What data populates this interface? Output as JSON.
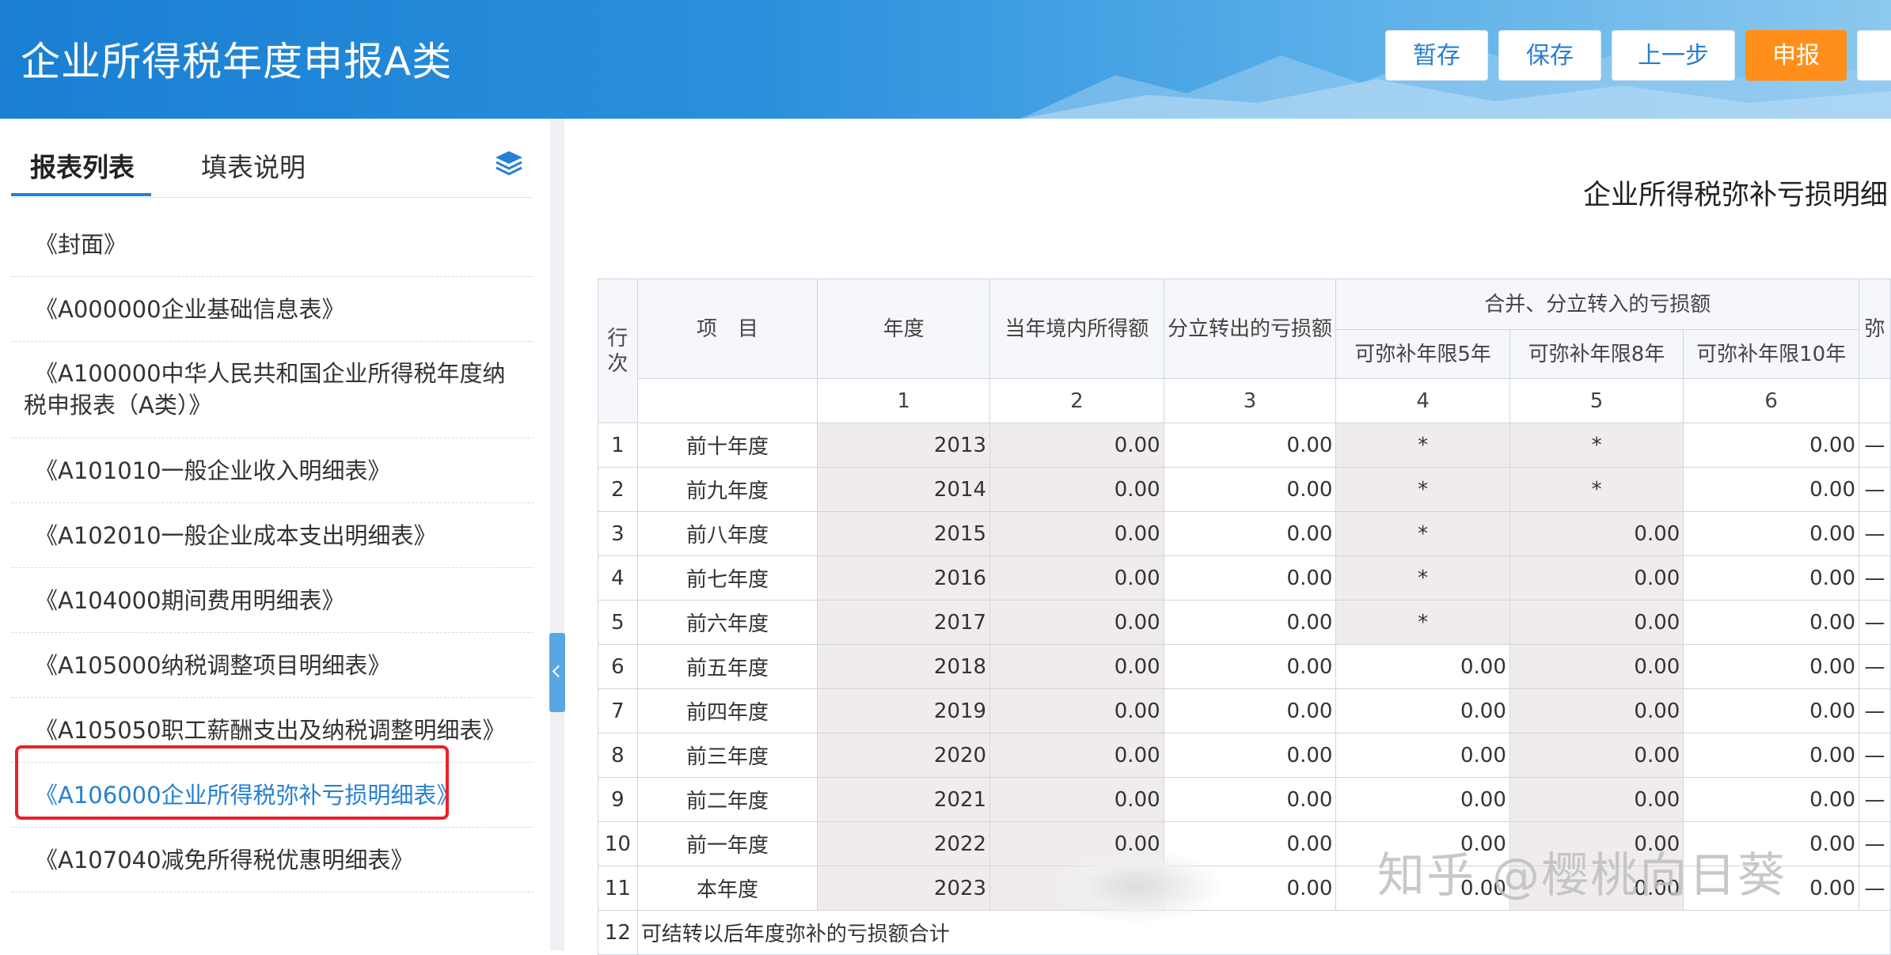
{
  "header": {
    "title": "企业所得税年度申报A类",
    "buttons": {
      "save_draft": "暂存",
      "save": "保存",
      "prev": "上一步",
      "submit": "申报"
    }
  },
  "sidebar": {
    "tabs": [
      "报表列表",
      "填表说明"
    ],
    "items": [
      {
        "lines": [
          "《封面》"
        ]
      },
      {
        "lines": [
          "《A000000企业基础信息表》"
        ]
      },
      {
        "lines": [
          "《A100000中华人民共和国企业所得税年度纳",
          "税申报表（A类）》"
        ]
      },
      {
        "lines": [
          "《A101010一般企业收入明细表》"
        ]
      },
      {
        "lines": [
          "《A102010一般企业成本支出明细表》"
        ]
      },
      {
        "lines": [
          "《A104000期间费用明细表》"
        ]
      },
      {
        "lines": [
          "《A105000纳税调整项目明细表》"
        ]
      },
      {
        "lines": [
          "《A105050职工薪酬支出及纳税调整明细表》"
        ]
      },
      {
        "lines": [
          "《A106000企业所得税弥补亏损明细表》"
        ]
      },
      {
        "lines": [
          "《A107040减免所得税优惠明细表》"
        ]
      }
    ]
  },
  "main": {
    "title": "企业所得税弥补亏损明细",
    "table": {
      "headers": {
        "row_no": "行次",
        "item": "项　目",
        "year": "年度",
        "income": "当年境内所得额",
        "split_out": "分立转出的亏损额",
        "merge_group": "合并、分立转入的亏损额",
        "limit5": "可弥补年限5年",
        "limit8": "可弥补年限8年",
        "limit10": "可弥补年限10年",
        "next_col": "弥",
        "col_nums": [
          "1",
          "2",
          "3",
          "4",
          "5",
          "6"
        ]
      },
      "rows": [
        {
          "no": "1",
          "item": "前十年度",
          "year": "2013",
          "c2": "0.00",
          "c3": "0.00",
          "c4": "*",
          "c5": "*",
          "c6": "0.00"
        },
        {
          "no": "2",
          "item": "前九年度",
          "year": "2014",
          "c2": "0.00",
          "c3": "0.00",
          "c4": "*",
          "c5": "*",
          "c6": "0.00"
        },
        {
          "no": "3",
          "item": "前八年度",
          "year": "2015",
          "c2": "0.00",
          "c3": "0.00",
          "c4": "*",
          "c5": "0.00",
          "c6": "0.00"
        },
        {
          "no": "4",
          "item": "前七年度",
          "year": "2016",
          "c2": "0.00",
          "c3": "0.00",
          "c4": "*",
          "c5": "0.00",
          "c6": "0.00"
        },
        {
          "no": "5",
          "item": "前六年度",
          "year": "2017",
          "c2": "0.00",
          "c3": "0.00",
          "c4": "*",
          "c5": "0.00",
          "c6": "0.00"
        },
        {
          "no": "6",
          "item": "前五年度",
          "year": "2018",
          "c2": "0.00",
          "c3": "0.00",
          "c4": "0.00",
          "c5": "0.00",
          "c6": "0.00"
        },
        {
          "no": "7",
          "item": "前四年度",
          "year": "2019",
          "c2": "0.00",
          "c3": "0.00",
          "c4": "0.00",
          "c5": "0.00",
          "c6": "0.00"
        },
        {
          "no": "8",
          "item": "前三年度",
          "year": "2020",
          "c2": "0.00",
          "c3": "0.00",
          "c4": "0.00",
          "c5": "0.00",
          "c6": "0.00"
        },
        {
          "no": "9",
          "item": "前二年度",
          "year": "2021",
          "c2": "0.00",
          "c3": "0.00",
          "c4": "0.00",
          "c5": "0.00",
          "c6": "0.00"
        },
        {
          "no": "10",
          "item": "前一年度",
          "year": "2022",
          "c2": "0.00",
          "c3": "0.00",
          "c4": "0.00",
          "c5": "0.00",
          "c6": "0.00"
        },
        {
          "no": "11",
          "item": "本年度",
          "year": "2023",
          "c2": "",
          "c3": "0.00",
          "c4": "0.00",
          "c5": "0.00",
          "c6": "0.00"
        }
      ],
      "row12": {
        "no": "12",
        "label": "可结转以后年度弥补的亏损额合计"
      }
    }
  },
  "watermark": "知乎 @樱桃向日葵",
  "colors": {
    "header_blue": "#1a7fd3",
    "submit_orange": "#ff8f1a",
    "link_blue": "#2680d4",
    "highlight_red": "#e8212a"
  }
}
